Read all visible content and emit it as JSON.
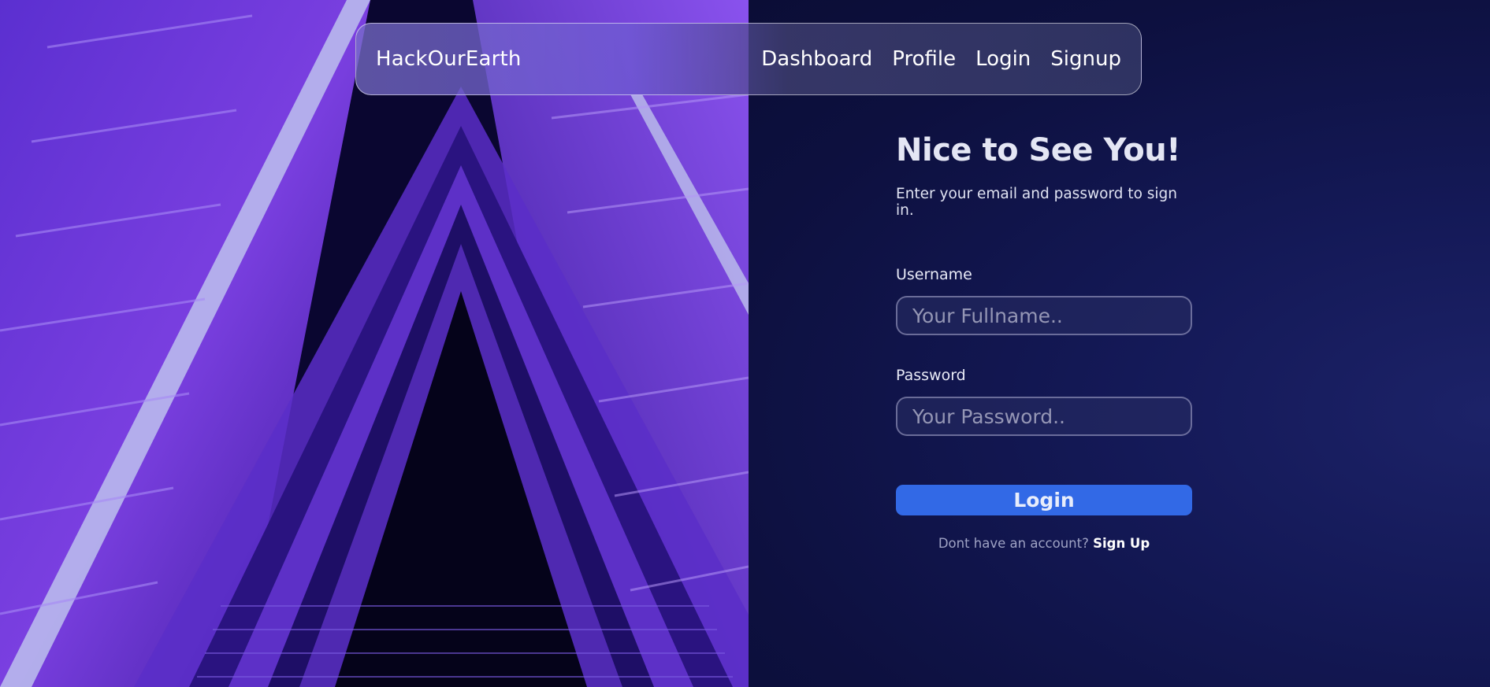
{
  "navbar": {
    "brand": "HackOurEarth",
    "links": [
      "Dashboard",
      "Profile",
      "Login",
      "Signup"
    ]
  },
  "login": {
    "title": "Nice to See You!",
    "subtitle": "Enter your email and password to sign in.",
    "username_label": "Username",
    "username_placeholder": "Your Fullname..",
    "username_value": "",
    "password_label": "Password",
    "password_placeholder": "Your Password..",
    "password_value": "",
    "submit_label": "Login",
    "footer_prompt": "Dont have an account?",
    "footer_link": "Sign Up"
  },
  "colors": {
    "background": "#0e1140",
    "accent_button": "#3269e6",
    "hero_purple": "#7a3fe0"
  }
}
